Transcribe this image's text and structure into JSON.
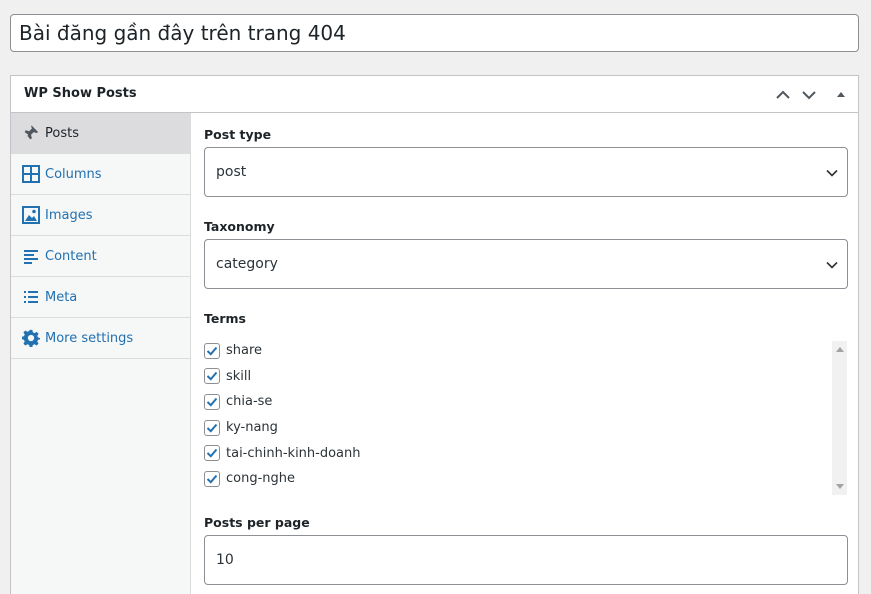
{
  "post_title": "Bài đăng gần đây trên trang 404",
  "metabox": {
    "title": "WP Show Posts"
  },
  "tabs": [
    {
      "label": "Posts",
      "icon": "pin-icon"
    },
    {
      "label": "Columns",
      "icon": "columns-icon"
    },
    {
      "label": "Images",
      "icon": "image-icon"
    },
    {
      "label": "Content",
      "icon": "content-align-icon"
    },
    {
      "label": "Meta",
      "icon": "list-icon"
    },
    {
      "label": "More settings",
      "icon": "gear-icon"
    }
  ],
  "fields": {
    "post_type": {
      "label": "Post type",
      "value": "post"
    },
    "taxonomy": {
      "label": "Taxonomy",
      "value": "category"
    },
    "terms": {
      "label": "Terms",
      "items": [
        {
          "label": "share",
          "checked": true
        },
        {
          "label": "skill",
          "checked": true
        },
        {
          "label": "chia-se",
          "checked": true
        },
        {
          "label": "ky-nang",
          "checked": true
        },
        {
          "label": "tai-chinh-kinh-doanh",
          "checked": true
        },
        {
          "label": "cong-nghe",
          "checked": true
        }
      ]
    },
    "posts_per_page": {
      "label": "Posts per page",
      "value": "10"
    }
  },
  "colors": {
    "accent": "#2271b1",
    "active_tab_bg": "#dcdcde"
  }
}
